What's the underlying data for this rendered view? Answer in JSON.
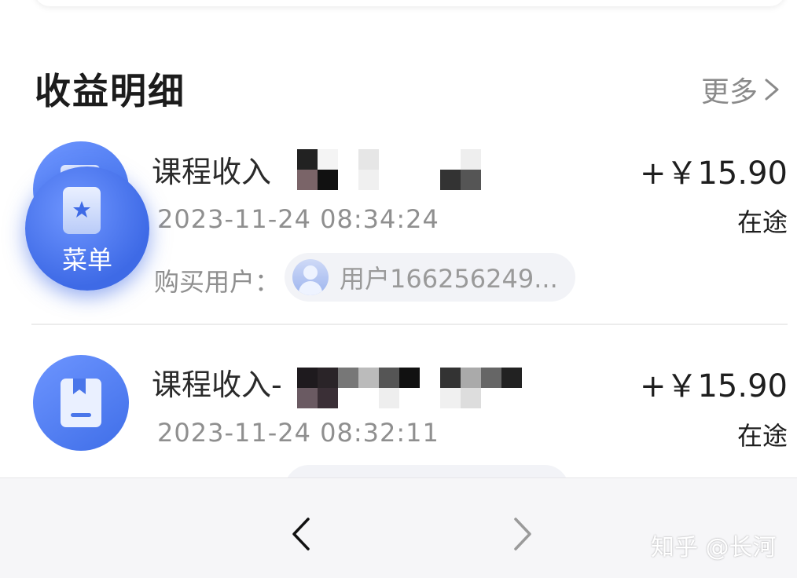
{
  "section": {
    "title": "收益明细",
    "more_label": "更多"
  },
  "records": [
    {
      "title": "课程收入",
      "amount": "+￥15.90",
      "time": "2023-11-24 08:34:24",
      "status": "在途",
      "buyer_label": "购买用户：",
      "buyer_name": "用户166256249...",
      "icon": "book-icon"
    },
    {
      "title": "课程收入-",
      "amount": "+￥15.90",
      "time": "2023-11-24 08:32:11",
      "status": "在途",
      "icon": "bookmark-book-icon"
    }
  ],
  "floating_menu": {
    "label": "菜单",
    "icon": "star-card-icon"
  },
  "bottom_nav": {
    "back_icon": "chevron-left-icon",
    "forward_icon": "chevron-right-icon"
  },
  "watermark": "知乎 @长河",
  "colors": {
    "accent_blue": "#3f6ee8",
    "muted_text": "#8f8f8f",
    "pill_bg": "#f2f3f7"
  }
}
